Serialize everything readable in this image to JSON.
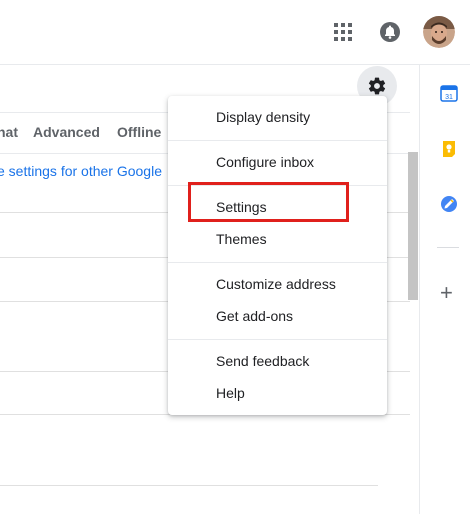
{
  "header": {
    "apps_icon": "apps-grid-icon",
    "notifications_icon": "bell-icon",
    "avatar_icon": "account-avatar"
  },
  "toolbar": {
    "settings_icon": "gear-icon"
  },
  "tabs": [
    {
      "label": "nat"
    },
    {
      "label": "Advanced"
    },
    {
      "label": "Offline"
    }
  ],
  "main": {
    "partial_link": "e settings for other Google"
  },
  "side_panel": {
    "apps": [
      "calendar-icon",
      "keep-icon",
      "tasks-icon"
    ],
    "add_label": "+"
  },
  "menu": {
    "items": [
      {
        "label": "Display density"
      },
      {
        "label": "Configure inbox"
      },
      {
        "label": "Settings"
      },
      {
        "label": "Themes"
      },
      {
        "label": "Customize address"
      },
      {
        "label": "Get add-ons"
      },
      {
        "label": "Send feedback"
      },
      {
        "label": "Help"
      }
    ]
  },
  "colors": {
    "highlight": "#e0201c",
    "link": "#1a73e8",
    "icon": "#5f6368"
  }
}
